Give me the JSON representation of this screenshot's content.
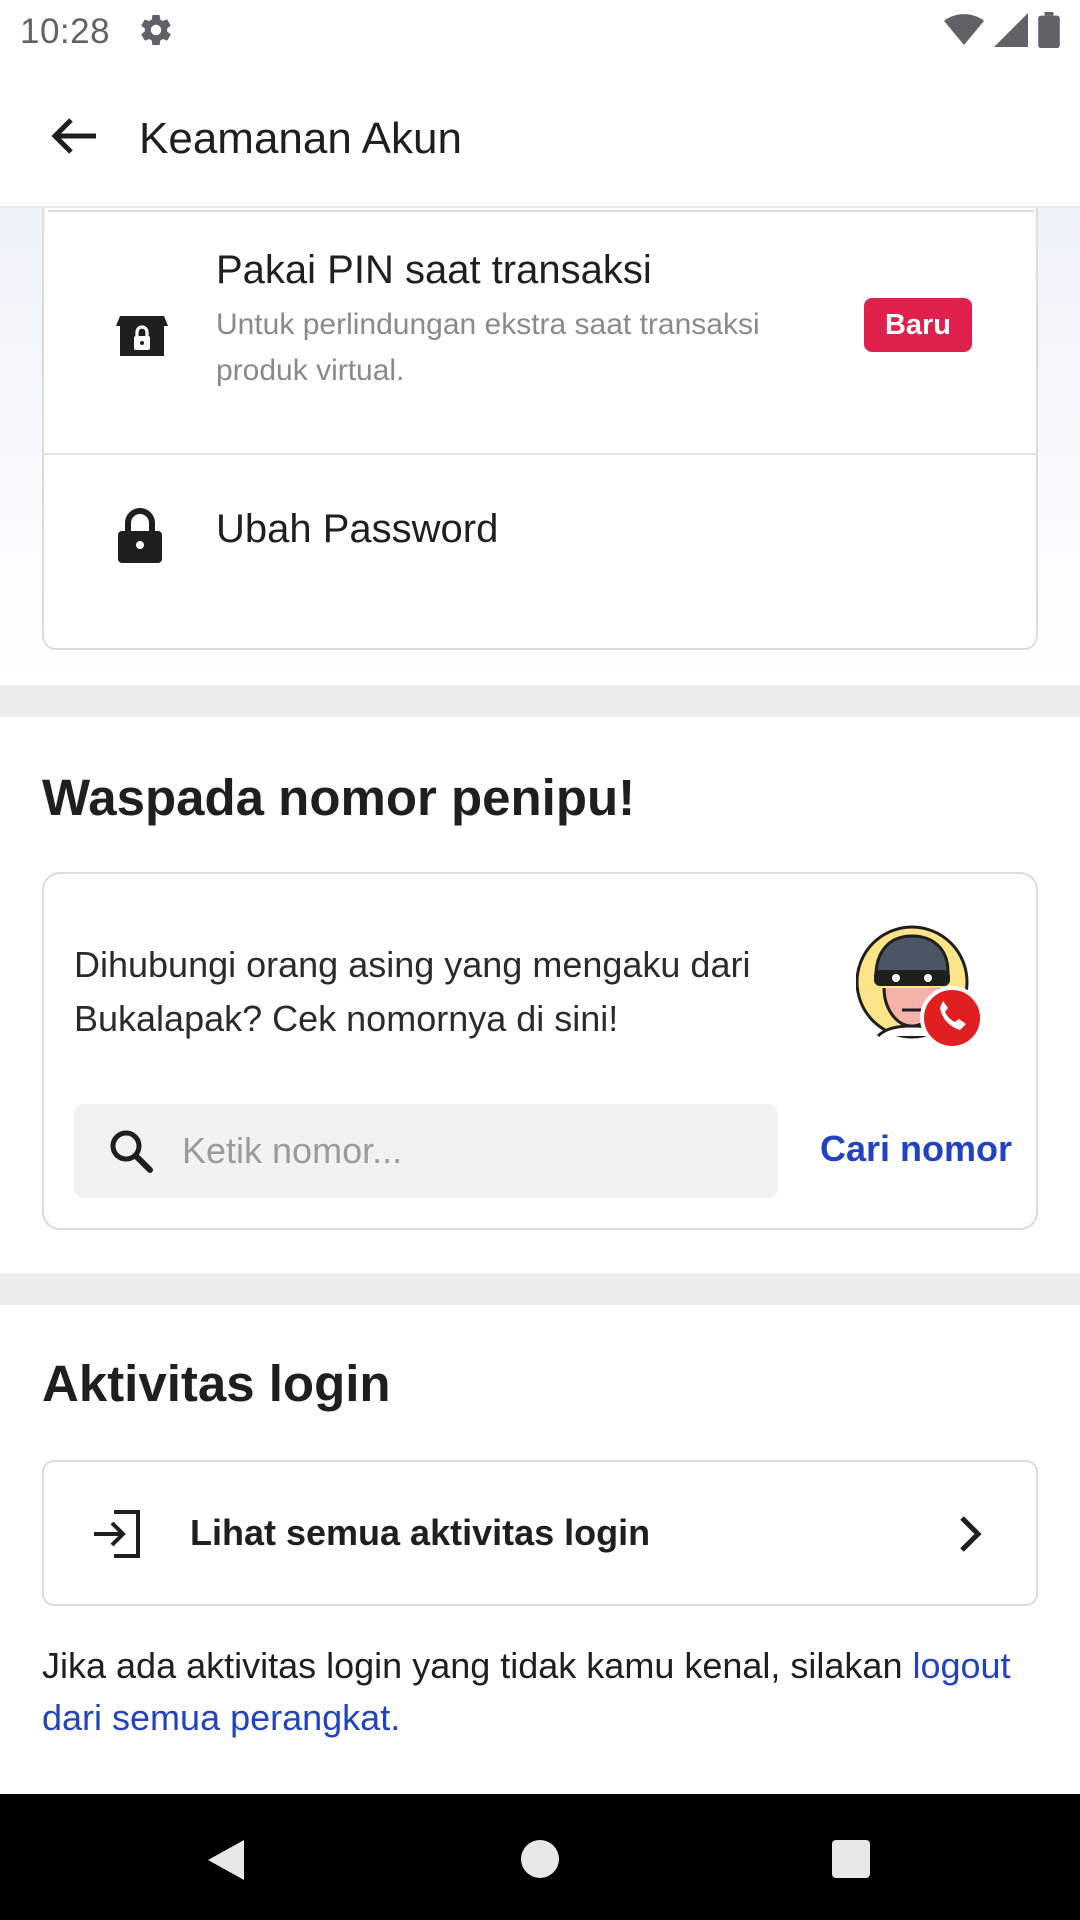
{
  "status_bar": {
    "time": "10:28"
  },
  "app_bar": {
    "title": "Keamanan Akun"
  },
  "security_options": [
    {
      "title": "Pakai PIN saat transaksi",
      "subtitle": "Untuk perlindungan ekstra saat transaksi produk virtual.",
      "badge": "Baru",
      "icon": "store-lock-icon"
    },
    {
      "title": "Ubah Password",
      "icon": "lock-icon"
    }
  ],
  "fraud_section": {
    "title": "Waspada nomor penipu!",
    "description": "Dihubungi orang asing yang mengaku dari Bukalapak? Cek nomornya di sini!",
    "search_placeholder": "Ketik nomor...",
    "search_button": "Cari nomor"
  },
  "login_section": {
    "title": "Aktivitas login",
    "view_all_label": "Lihat semua aktivitas login",
    "notice_text": "Jika ada aktivitas login yang tidak kamu kenal, silakan ",
    "notice_link": "logout dari semua perangkat."
  },
  "colors": {
    "accent_blue": "#2243c1",
    "badge_red": "#e0214d",
    "divider": "#dcdcdc"
  }
}
